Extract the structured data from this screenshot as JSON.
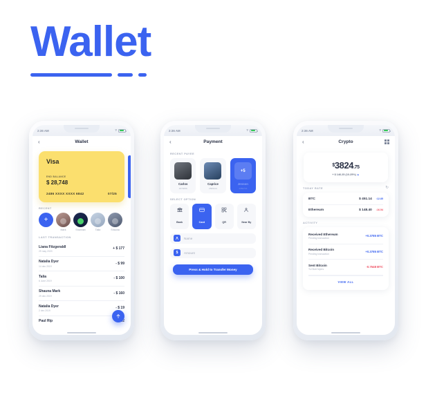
{
  "hero": {
    "title": "Wallet"
  },
  "statusbar": {
    "time": "2:36 AM",
    "wifi_icon": "wifi-icon",
    "battery_icon": "battery-icon"
  },
  "phone1": {
    "appbar": {
      "back_icon": "chevron-left-icon",
      "title": "Wallet"
    },
    "card": {
      "brand": "Visa",
      "balance_label": "END BALANCE",
      "balance": "$ 28,748",
      "number": "2486 XXXX XXXX 6842",
      "expiry": "07/25"
    },
    "recent_label": "RECENT",
    "recent": [
      {
        "name": "",
        "type": "add",
        "icon": "plus-icon"
      },
      {
        "name": "Mark",
        "type": "photo"
      },
      {
        "name": "Shannan",
        "type": "photo"
      },
      {
        "name": "Talia",
        "type": "photo"
      },
      {
        "name": "Shauna",
        "type": "photo"
      }
    ],
    "transactions_label": "LAST TRANSACTION",
    "transactions": [
      {
        "name": "Liana Fitzgeraldl",
        "date": "29 may 2020",
        "amount": "+ $ 177"
      },
      {
        "name": "Natalia Dyer",
        "date": "14 dec 2019",
        "amount": "- $ 99"
      },
      {
        "name": "Talia",
        "date": "6 June 2019",
        "amount": "- $ 100"
      },
      {
        "name": "Shauna Mark",
        "date": "29 dec 2019",
        "amount": "- $ 160"
      },
      {
        "name": "Natalia Dyer",
        "date": "2 dec 2019",
        "amount": "- $ 19"
      },
      {
        "name": "Paul Rip",
        "date": "",
        "amount": "- $ 62"
      }
    ],
    "fab_icon": "send-icon"
  },
  "phone2": {
    "appbar": {
      "back_icon": "chevron-left-icon",
      "title": "Payment"
    },
    "payee_label": "RECENT PAYEE",
    "payees": [
      {
        "name": "Carlos",
        "id": "1870056",
        "selected": false
      },
      {
        "name": "Caprice",
        "id": "2589101",
        "selected": false
      },
      {
        "name": "Jenson",
        "id": "1350716",
        "selected": true,
        "badge": "+5"
      }
    ],
    "options_label": "SELECT OPTION",
    "options": [
      {
        "label": "Bank",
        "icon": "bank-icon",
        "glyph": "🏛",
        "selected": false
      },
      {
        "label": "Card",
        "icon": "card-icon",
        "glyph": "▤",
        "selected": true
      },
      {
        "label": "QR",
        "icon": "qr-icon",
        "glyph": "▒",
        "selected": false
      },
      {
        "label": "Near By",
        "icon": "nearby-icon",
        "glyph": "◎",
        "selected": false
      }
    ],
    "fields": [
      {
        "placeholder": "Name",
        "icon": "person-icon",
        "glyph": "●"
      },
      {
        "placeholder": "Amount",
        "icon": "dollar-icon",
        "glyph": "$"
      }
    ],
    "cta_label": "Press & Hold to Transfer Money"
  },
  "phone3": {
    "appbar": {
      "back_icon": "chevron-left-icon",
      "title": "Crypto",
      "right_icon": "qr-scan-icon"
    },
    "balance": {
      "currency": "$",
      "whole": "3824",
      "decimal": ".75",
      "change": "+ $ 146.25 (10.25%)",
      "change_icon": "arrow-up-icon"
    },
    "rate_label": "TODAY RATE",
    "refresh_icon": "refresh-icon",
    "rates": [
      {
        "name": "BTC",
        "value": "$ 451.14",
        "delta": "12.85",
        "dir": "up",
        "arrow": "↑"
      },
      {
        "name": "Ethereum",
        "value": "$ 148.40",
        "delta": "16.54",
        "dir": "down",
        "arrow": "↓"
      }
    ],
    "activity_label": "ACTIVITY",
    "activity": [
      {
        "title": "Received Ethereum",
        "sub": "Pending transaction",
        "value": "+0.3785 BTC",
        "dir": "up"
      },
      {
        "title": "Received Bitcoin",
        "sub": "Pending transaction",
        "value": "+0.3785 BTC",
        "dir": "up"
      },
      {
        "title": "Sent Bitcoin",
        "sub": "To Eliott Myers",
        "value": "-0.7548 BTC",
        "dir": "down"
      }
    ],
    "view_all": "VIEW ALL"
  },
  "colors": {
    "accent": "#3b63f0",
    "card": "#fbdf6e",
    "up": "#3b63f0",
    "down": "#ef4b5e"
  }
}
